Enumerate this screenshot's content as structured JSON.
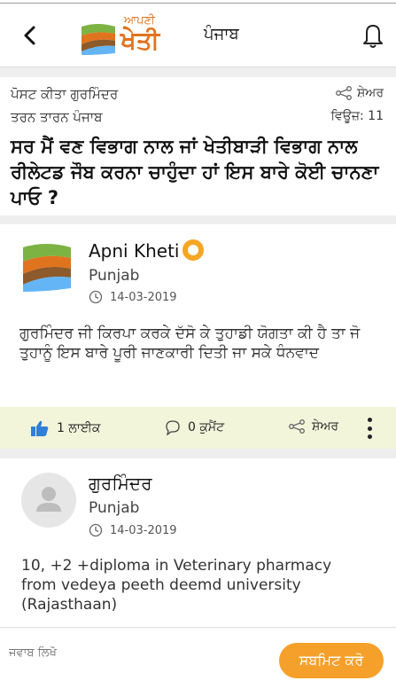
{
  "header": {
    "logo_small": "ਆਪਣੀ",
    "logo_big": "ਖੇਤੀ",
    "state": "ਪੰਜਾਬ",
    "icons": {
      "back": "chevron-left-icon",
      "notifications": "bell-icon"
    }
  },
  "post": {
    "posted_by": "ਪੋਸਟ ਕੀਤਾ ਗੁਰਮਿੰਦਰ",
    "location": "ਤਰਨ ਤਾਰਨ ਪੰਜਾਬ",
    "share_label": "ਸ਼ੇਅਰ",
    "views": "ਵਿਊਜ਼: 11",
    "question": "ਸਰ ਮੈਂ ਵਣ ਵਿਭਾਗ ਨਾਲ ਜਾਂ ਖੇਤੀਬਾੜੀ ਵਿਭਾਗ ਨਾਲ ਰੀਲੇਟਡ ਜੌਬ ਕਰਨਾ ਚਾਹੁੰਦਾ ਹਾਂ ਇਸ ਬਾਰੇ ਕੋਈ ਚਾਨਣਾ ਪਾਓ ?"
  },
  "answers": [
    {
      "name": "Apni Kheti",
      "place": "Punjab",
      "date": "14-03-2019",
      "text": "ਗੁਰਮਿੰਦਰ ਜੀ ਕਿਰਪਾ ਕਰਕੇ ਦੱਸੋ ਕੇ ਤੁਹਾਡੀ ਯੋਗਤਾ ਕੀ ਹੈ ਤਾ ਜੋ ਤੁਹਾਨੂੰ ਇਸ ਬਾਰੇ ਪੂਰੀ ਜਾਣਕਾਰੀ ਦਿਤੀ ਜਾ ਸਕੇ ਧੰਨਵਾਦ",
      "like_label": "1 ਲਾਈਕ",
      "comment_label": "0 ਕੁਮੈਂਟ",
      "share_label": "ਸ਼ੇਅਰ"
    },
    {
      "name": "ਗੁਰਮਿੰਦਰ",
      "place": "Punjab",
      "date": "14-03-2019",
      "text": "10, +2 +diploma in Veterinary pharmacy from vedeya peeth deemd university (Rajasthaan)"
    }
  ],
  "reply": {
    "placeholder": "ਜਵਾਬ ਲਿਖੋ",
    "submit_label": "ਸਬਮਿਟ ਕਰੋ"
  },
  "colors": {
    "accent_orange": "#f5a02a",
    "action_bar": "#f2f5da",
    "like_blue": "#2f7fd8"
  }
}
